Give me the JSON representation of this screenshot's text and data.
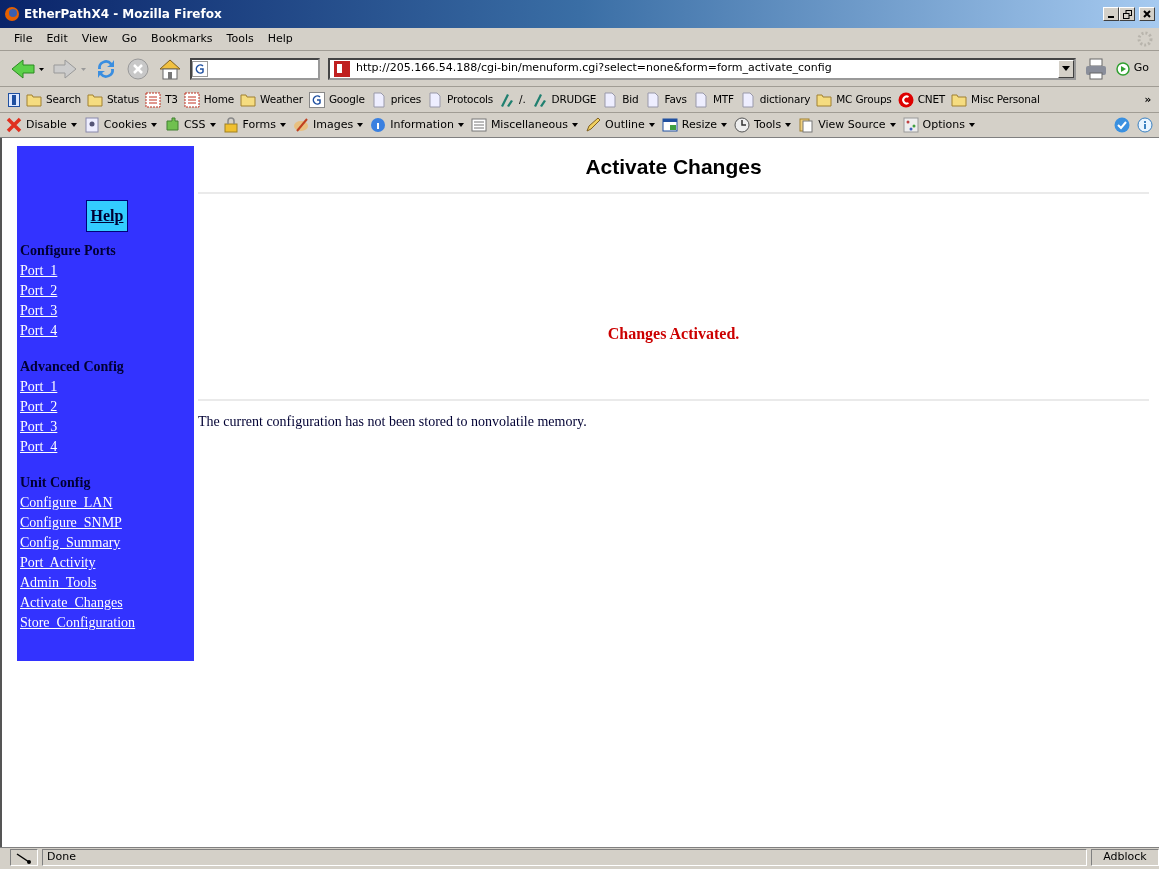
{
  "window": {
    "title": "EtherPathX4 - Mozilla Firefox"
  },
  "menu": [
    "File",
    "Edit",
    "View",
    "Go",
    "Bookmarks",
    "Tools",
    "Help"
  ],
  "navbar": {
    "url": "http://205.166.54.188/cgi-bin/menuform.cgi?select=none&form=form_activate_config",
    "go": "Go"
  },
  "bookmarks": [
    {
      "label": "Search",
      "kind": "folder"
    },
    {
      "label": "Status",
      "kind": "folder"
    },
    {
      "label": "T3",
      "kind": "grid"
    },
    {
      "label": "Home",
      "kind": "grid"
    },
    {
      "label": "Weather",
      "kind": "folder"
    },
    {
      "label": "Google",
      "kind": "g"
    },
    {
      "label": "prices",
      "kind": "page"
    },
    {
      "label": "Protocols",
      "kind": "page"
    },
    {
      "label": "/.",
      "kind": "slash"
    },
    {
      "label": "DRUDGE",
      "kind": "slash"
    },
    {
      "label": "Bid",
      "kind": "page"
    },
    {
      "label": "Favs",
      "kind": "page"
    },
    {
      "label": "MTF",
      "kind": "page"
    },
    {
      "label": "dictionary",
      "kind": "page"
    },
    {
      "label": "MC Groups",
      "kind": "folder"
    },
    {
      "label": "CNET",
      "kind": "cnet"
    },
    {
      "label": "Misc Personal",
      "kind": "folder"
    }
  ],
  "more": "»",
  "devtools": [
    "Disable",
    "Cookies",
    "CSS",
    "Forms",
    "Images",
    "Information",
    "Miscellaneous",
    "Outline",
    "Resize",
    "Tools",
    "View Source",
    "Options"
  ],
  "sidebar": {
    "help": "Help",
    "sections": [
      {
        "title": "Configure Ports",
        "links": [
          "Port  1",
          "Port  2",
          "Port  3",
          "Port  4"
        ]
      },
      {
        "title": "Advanced Config",
        "links": [
          "Port  1",
          "Port  2",
          "Port  3",
          "Port  4"
        ]
      },
      {
        "title": "Unit Config",
        "links": [
          "Configure  LAN",
          "Configure  SNMP",
          "Config  Summary",
          "Port  Activity",
          "Admin  Tools",
          "Activate  Changes",
          "Store  Configuration"
        ]
      }
    ]
  },
  "page": {
    "heading": "Activate Changes",
    "message": "Changes Activated.",
    "note": "The current configuration has not been stored to nonvolatile memory."
  },
  "status_bar": {
    "text": "Done",
    "right": "Adblock"
  }
}
